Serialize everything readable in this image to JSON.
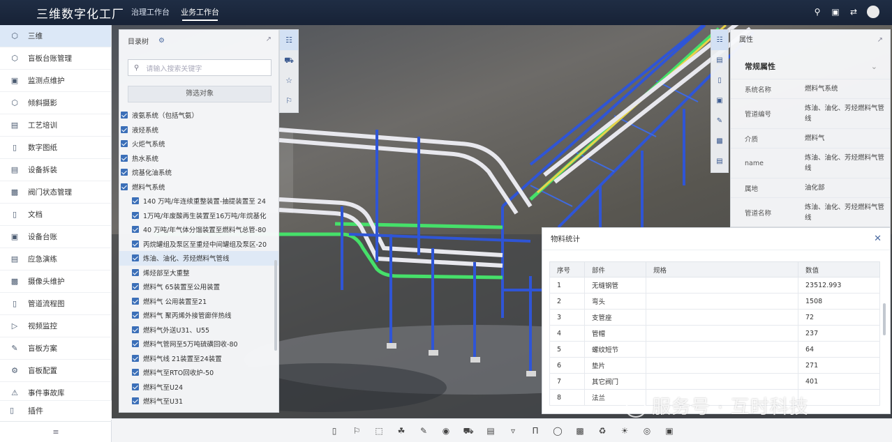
{
  "app": {
    "title": "三维数字化工厂",
    "tabs": [
      {
        "label": "治理工作台",
        "active": false
      },
      {
        "label": "业务工作台",
        "active": true
      }
    ],
    "top_icons": [
      "search-icon",
      "monitor-icon",
      "share-icon",
      "avatar"
    ]
  },
  "sidebar": {
    "items": [
      {
        "label": "三维",
        "icon": "cube-icon",
        "active": true
      },
      {
        "label": "盲板台账管理",
        "icon": "cube-icon"
      },
      {
        "label": "监测点维护",
        "icon": "monitor-point-icon"
      },
      {
        "label": "倾斜摄影",
        "icon": "cube-icon"
      },
      {
        "label": "工艺培训",
        "icon": "training-icon"
      },
      {
        "label": "数字图纸",
        "icon": "drawing-icon"
      },
      {
        "label": "设备拆装",
        "icon": "device-icon"
      },
      {
        "label": "阀门状态管理",
        "icon": "valve-icon"
      },
      {
        "label": "文档",
        "icon": "document-icon"
      },
      {
        "label": "设备台账",
        "icon": "ledger-icon"
      },
      {
        "label": "应急演练",
        "icon": "emergency-icon"
      },
      {
        "label": "摄像头维护",
        "icon": "camera-icon"
      },
      {
        "label": "管道流程图",
        "icon": "flowchart-icon"
      },
      {
        "label": "视频监控",
        "icon": "video-icon"
      },
      {
        "label": "盲板方案",
        "icon": "plan-icon"
      },
      {
        "label": "盲板配置",
        "icon": "config-icon"
      },
      {
        "label": "事件事故库",
        "icon": "event-icon"
      }
    ],
    "plugin_label": "插件",
    "foot_icon": "collapse-icon"
  },
  "catalog": {
    "title": "目录树",
    "search_placeholder": "请输入搜索关键字",
    "filter_label": "筛选对象",
    "items": [
      {
        "label": "液氨系统（包括气氨）",
        "level": 0
      },
      {
        "label": "液烃系统",
        "level": 0
      },
      {
        "label": "火炬气系统",
        "level": 0
      },
      {
        "label": "热水系统",
        "level": 0
      },
      {
        "label": "烷基化油系统",
        "level": 0
      },
      {
        "label": "燃料气系统",
        "level": 0
      },
      {
        "label": "140 万吨/年连续重整装置-抽提装置至 24",
        "level": 1
      },
      {
        "label": "1万吨/年废酸再生装置至16万吨/年烷基化",
        "level": 1
      },
      {
        "label": "40 万吨/年气体分馏装置至燃料气总管-80",
        "level": 1
      },
      {
        "label": "丙烷罐组及泵区至重烃中间罐组及泵区-20",
        "level": 1
      },
      {
        "label": "炼油、油化、芳烃燃料气管线",
        "level": 1,
        "selected": true
      },
      {
        "label": "烯烃部至大重整",
        "level": 1
      },
      {
        "label": "燃料气 65装置至公用装置",
        "level": 1
      },
      {
        "label": "燃料气 公用装置至21",
        "level": 1
      },
      {
        "label": "燃料气 聚丙烯外接管廊伴热线",
        "level": 1
      },
      {
        "label": "燃料气外送U31、U55",
        "level": 1
      },
      {
        "label": "燃料气管网至5万吨硫磺回收-80",
        "level": 1
      },
      {
        "label": "燃料气线 21装置至24装置",
        "level": 1
      },
      {
        "label": "燃料气至RTO回收炉-50",
        "level": 1
      },
      {
        "label": "燃料气至U24",
        "level": 1
      },
      {
        "label": "燃料气至U31",
        "level": 1
      }
    ]
  },
  "left_tools": [
    "hierarchy-icon",
    "vehicle-icon",
    "star-icon",
    "flag-icon"
  ],
  "right_tools": [
    "tool-a-icon",
    "tool-b-icon",
    "tool-c-icon",
    "tool-d-icon",
    "tool-e-icon",
    "tool-f-icon",
    "tool-g-icon"
  ],
  "properties": {
    "title": "属性",
    "group": "常规属性",
    "rows": [
      {
        "key": "系统名称",
        "value": "燃料气系统"
      },
      {
        "key": "管道编号",
        "value": "炼油、油化、芳烃燃料气管线"
      },
      {
        "key": "介质",
        "value": "燃料气"
      },
      {
        "key": "name",
        "value": "炼油、油化、芳烃燃料气管线"
      },
      {
        "key": "属地",
        "value": "油化部"
      },
      {
        "key": "管道名称",
        "value": "炼油、油化、芳烃燃料气管线"
      }
    ]
  },
  "stats": {
    "title": "物料统计",
    "columns": [
      "序号",
      "部件",
      "规格",
      "数值"
    ],
    "rows": [
      {
        "no": "1",
        "part": "无缝钢管",
        "spec": "",
        "value": "23512.993"
      },
      {
        "no": "2",
        "part": "弯头",
        "spec": "",
        "value": "1508"
      },
      {
        "no": "3",
        "part": "支管座",
        "spec": "",
        "value": "72"
      },
      {
        "no": "4",
        "part": "管帽",
        "spec": "",
        "value": "237"
      },
      {
        "no": "5",
        "part": "螺纹短节",
        "spec": "",
        "value": "64"
      },
      {
        "no": "6",
        "part": "垫片",
        "spec": "",
        "value": "271"
      },
      {
        "no": "7",
        "part": "其它阀门",
        "spec": "",
        "value": "401"
      },
      {
        "no": "8",
        "part": "法兰",
        "spec": "",
        "value": ""
      }
    ]
  },
  "bottom_tools": [
    "doc-tool-icon",
    "flag-tool-icon",
    "frame-tool-icon",
    "fill-tool-icon",
    "measure-tool-icon",
    "camera-tool-icon",
    "car-tool-icon",
    "view-tool-icon",
    "section-tool-icon",
    "ruler-tool-icon",
    "mouse-tool-icon",
    "layer-tool-icon",
    "delete-tool-icon",
    "weather-tool-icon",
    "vr-tool-icon",
    "box-tool-icon"
  ],
  "watermark": "服务号 · 互时科技",
  "colors": {
    "accent": "#3b6fb8",
    "pipe_blue": "#2f55d6",
    "pipe_green": "#46e06a",
    "pipe_white": "#e8e8ee"
  }
}
